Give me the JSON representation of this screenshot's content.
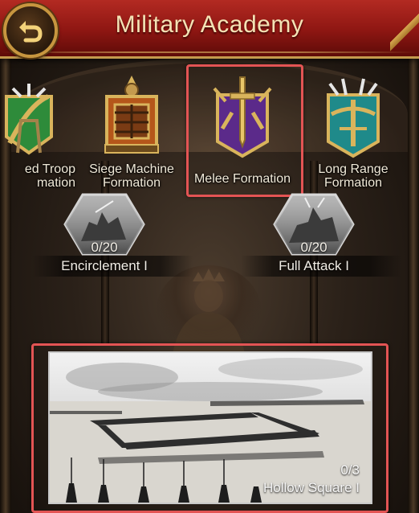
{
  "header": {
    "title": "Military Academy",
    "back_icon": "return-arrow-icon"
  },
  "formations": [
    {
      "label": "ed Troop\nmation",
      "icon": "mixed-troop-emblem-icon",
      "accent": "#2e8b3a"
    },
    {
      "label": "Siege Machine\nFormation",
      "icon": "siege-machine-emblem-icon",
      "accent": "#b5561a"
    },
    {
      "label": "Melee Formation",
      "icon": "melee-sword-emblem-icon",
      "accent": "#5b2a8a",
      "selected": true
    },
    {
      "label": "Long Range\nFormation",
      "icon": "long-range-crossbow-emblem-icon",
      "accent": "#1f8a8a"
    }
  ],
  "skills": [
    {
      "count": "0/20",
      "name": "Encirclement I",
      "icon": "cavalry-battle-icon"
    },
    {
      "count": "0/20",
      "name": "Full Attack I",
      "icon": "cavalry-charge-icon"
    }
  ],
  "bottom_card": {
    "count": "0/3",
    "name": "Hollow Square I",
    "image": "army-hollow-square-formation-illustration"
  },
  "colors": {
    "header_red": "#8d1612",
    "gold": "#c7963f",
    "highlight": "#e35454",
    "text": "#f1ead9"
  }
}
